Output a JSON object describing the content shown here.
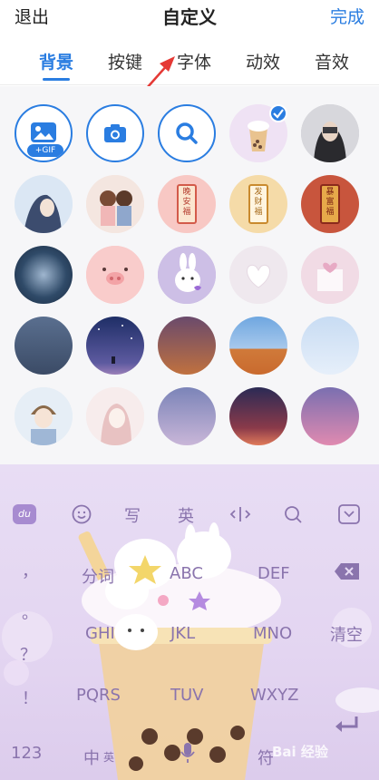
{
  "header": {
    "exit_label": "退出",
    "title": "自定义",
    "done_label": "完成"
  },
  "tabs": [
    {
      "label": "背景",
      "active": true
    },
    {
      "label": "按键",
      "active": false
    },
    {
      "label": "字体",
      "active": false
    },
    {
      "label": "动效",
      "active": false
    },
    {
      "label": "音效",
      "active": false
    }
  ],
  "tools": {
    "gif_badge": "+GIF"
  },
  "thumbs": {
    "fortune_1": "晚安福",
    "fortune_2": "发财福",
    "fortune_3": "暴富福"
  },
  "keyboard": {
    "toolbar": {
      "write": "写",
      "english": "英"
    },
    "keys": {
      "comma": "，",
      "fenci": "分词",
      "abc": "ABC",
      "def": "DEF",
      "period": "。",
      "ghi": "GHI",
      "jkl": "JKL",
      "mno": "MNO",
      "clear": "清空",
      "question": "？",
      "exclaim": "！",
      "pqrs": "PQRS",
      "tuv": "TUV",
      "wxyz": "WXYZ",
      "num": "123",
      "zhong": "中",
      "ying_small": "英",
      "fu": "符"
    }
  },
  "watermark": "Bai 经验",
  "colors": {
    "accent": "#2a7de1",
    "keyboard_bg": "#e6daf3",
    "key_text": "#8a74ad"
  }
}
